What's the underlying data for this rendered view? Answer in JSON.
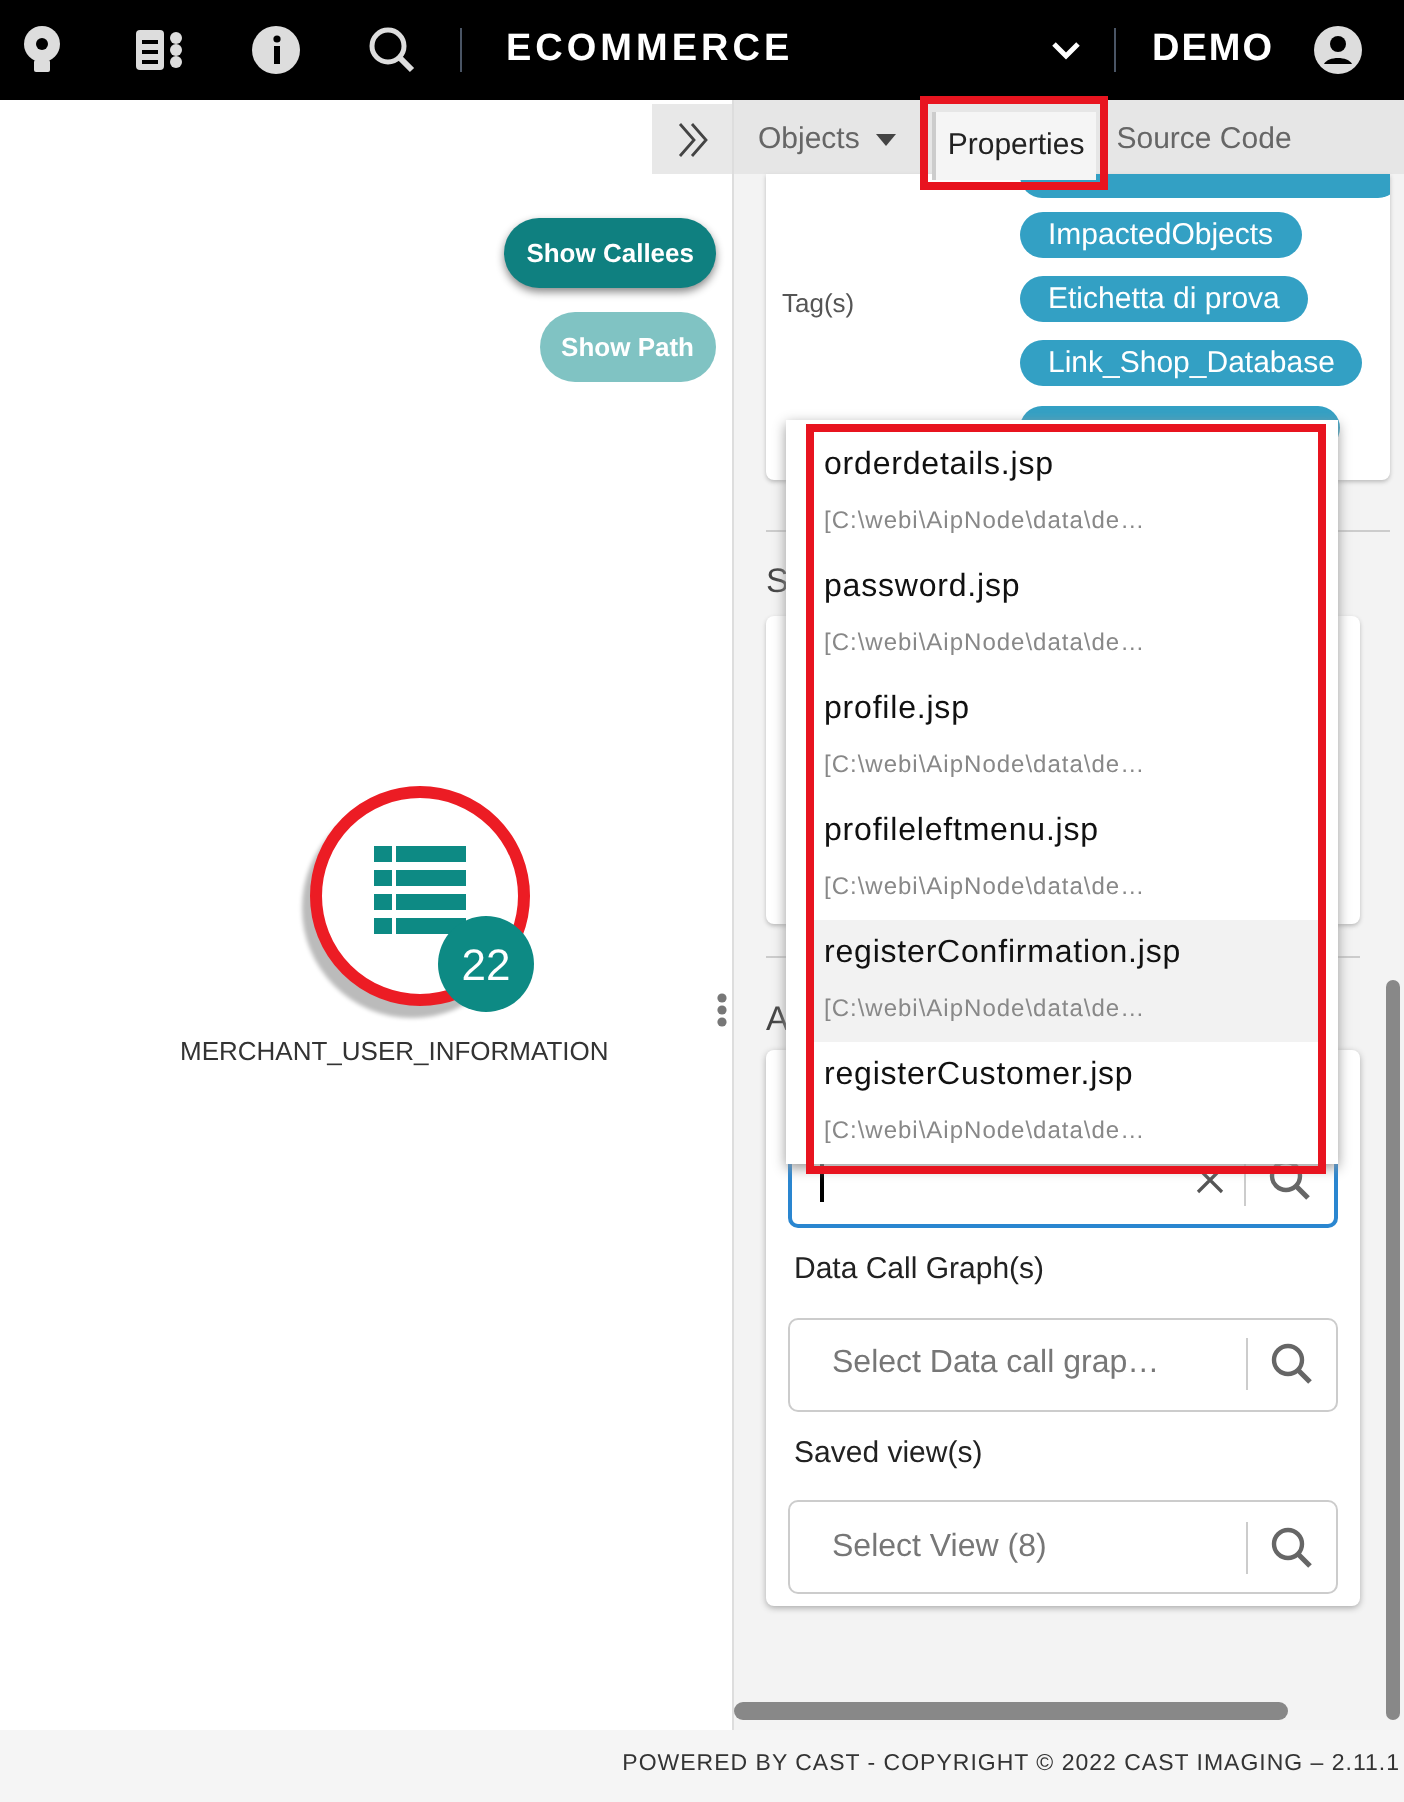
{
  "top_bar": {
    "app_name": "ECOMMERCE",
    "user": "DEMO"
  },
  "canvas": {
    "buttons": [
      {
        "label": "Show Callees",
        "kind": "primary"
      },
      {
        "label": "Show Path",
        "kind": "secondary"
      }
    ],
    "node": {
      "label": "MERCHANT_USER_INFORMATION",
      "count": "22",
      "highlighted": true
    }
  },
  "panel": {
    "tabs": [
      {
        "label": "Objects",
        "selected": false,
        "dropdown": true
      },
      {
        "label": "Properties",
        "selected": true,
        "dropdown": false
      },
      {
        "label": "Source Code",
        "selected": false,
        "dropdown": false
      }
    ],
    "tags_label": "Tag(s)",
    "tags": [
      "ImpactedObjects",
      "Etichetta di prova",
      "Link_Shop_Database"
    ],
    "section_2_heading": "S",
    "section_3_heading": "A",
    "data_call_graphs": {
      "label": "Data Call Graph(s)",
      "placeholder": "Select Data call grap…"
    },
    "saved_views": {
      "label": "Saved view(s)",
      "placeholder": "Select View (8)"
    }
  },
  "dropdown": {
    "items": [
      {
        "name": "orderdetails.jsp",
        "path": "[C:\\webi\\AipNode\\data\\de…",
        "highlighted": false
      },
      {
        "name": "password.jsp",
        "path": "[C:\\webi\\AipNode\\data\\de…",
        "highlighted": false
      },
      {
        "name": "profile.jsp",
        "path": "[C:\\webi\\AipNode\\data\\de…",
        "highlighted": false
      },
      {
        "name": "profileleftmenu.jsp",
        "path": "[C:\\webi\\AipNode\\data\\de…",
        "highlighted": false
      },
      {
        "name": "registerConfirmation.jsp",
        "path": "[C:\\webi\\AipNode\\data\\de…",
        "highlighted": true
      },
      {
        "name": "registerCustomer.jsp",
        "path": "[C:\\webi\\AipNode\\data\\de…",
        "highlighted": false
      }
    ]
  },
  "footer": "POWERED BY CAST - COPYRIGHT © 2022 CAST IMAGING – 2.11.1"
}
